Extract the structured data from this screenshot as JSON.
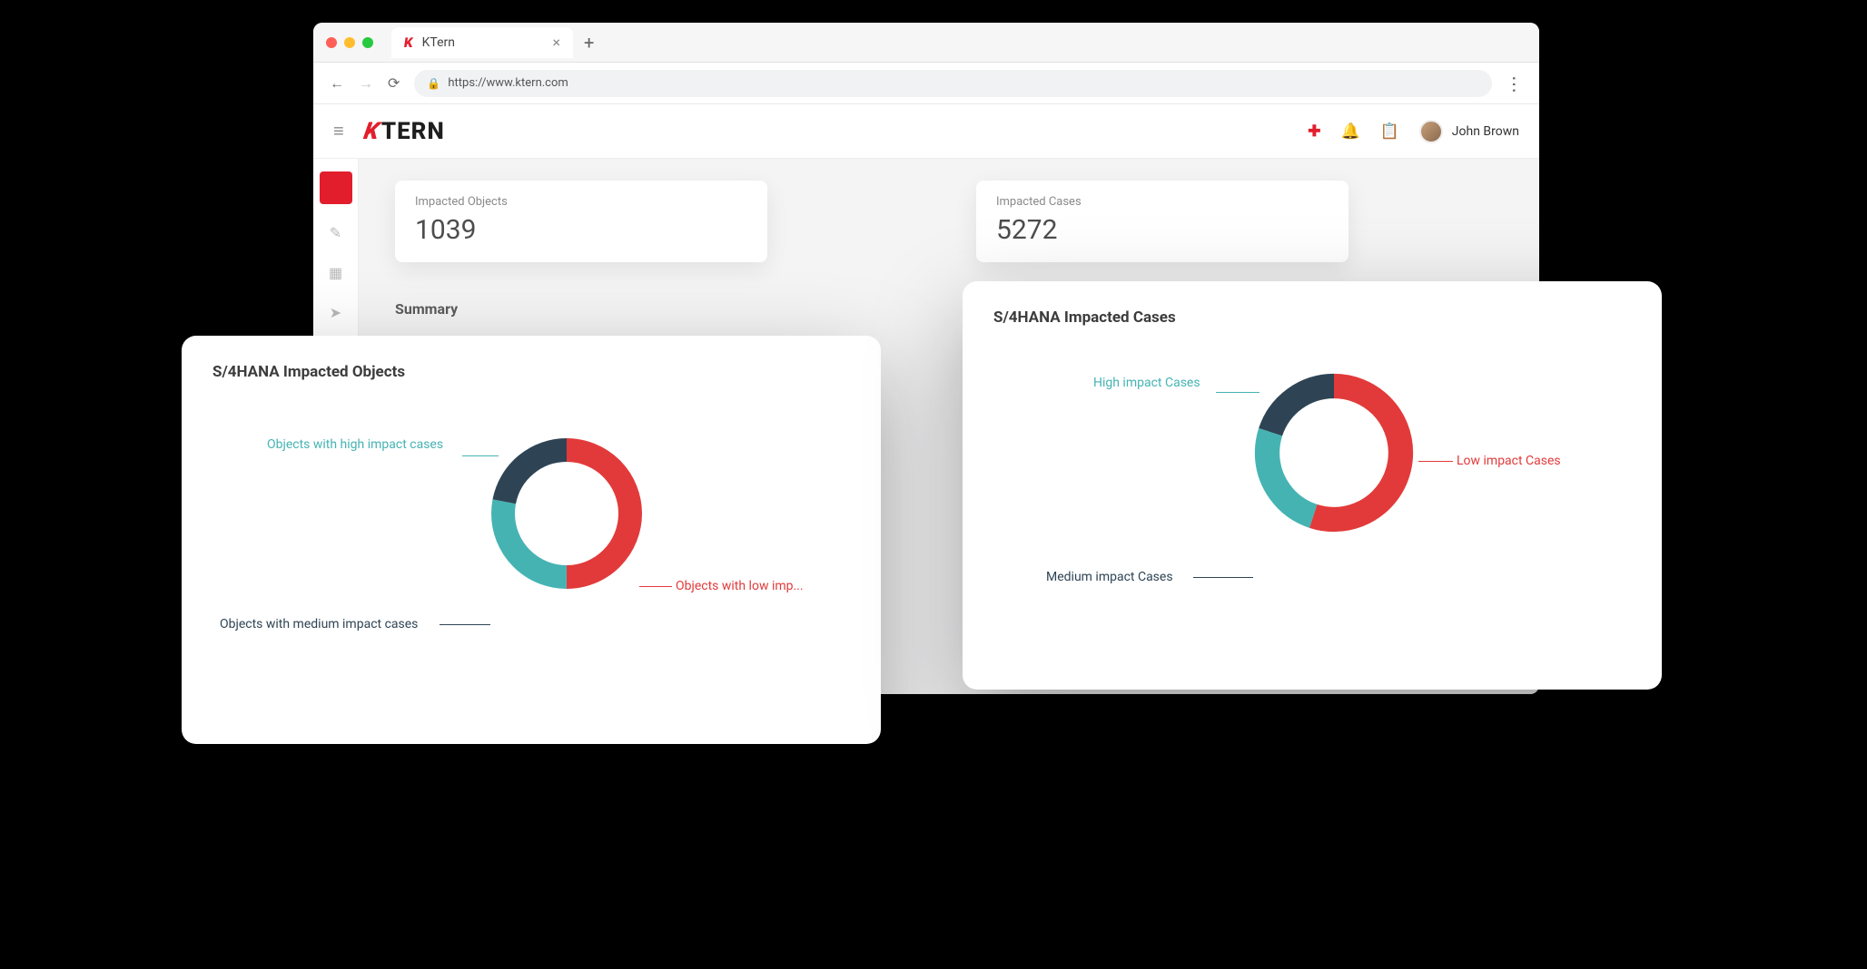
{
  "browser": {
    "tab_title": "KTern",
    "url": "https://www.ktern.com"
  },
  "header": {
    "brand_k": "K",
    "brand_rest": "TERN",
    "user_name": "John Brown"
  },
  "sidebar": {
    "items": [
      "home",
      "edit",
      "apps",
      "send",
      "more"
    ]
  },
  "metrics": [
    {
      "label": "Impacted Objects",
      "value": "1039"
    },
    {
      "label": "Impacted Cases",
      "value": "5272"
    }
  ],
  "summary_heading": "Summary",
  "charts": {
    "objects": {
      "title": "S/4HANA Impacted Objects",
      "labels": {
        "high": "Objects with high impact cases",
        "medium": "Objects with medium impact cases",
        "low": "Objects with low imp..."
      }
    },
    "cases": {
      "title": "S/4HANA Impacted Cases",
      "labels": {
        "high": "High impact Cases",
        "medium": "Medium impact Cases",
        "low": "Low impact Cases"
      }
    }
  },
  "chart_data": [
    {
      "type": "pie",
      "title": "S/4HANA Impacted Objects",
      "series": [
        {
          "name": "Objects with low impact cases",
          "value": 50,
          "color": "#e23a3a"
        },
        {
          "name": "Objects with high impact cases",
          "value": 28,
          "color": "#46b3b3"
        },
        {
          "name": "Objects with medium impact cases",
          "value": 22,
          "color": "#2e4454"
        }
      ]
    },
    {
      "type": "pie",
      "title": "S/4HANA Impacted Cases",
      "series": [
        {
          "name": "Low impact Cases",
          "value": 55,
          "color": "#e23a3a"
        },
        {
          "name": "High impact Cases",
          "value": 25,
          "color": "#46b3b3"
        },
        {
          "name": "Medium impact Cases",
          "value": 20,
          "color": "#2e4454"
        }
      ]
    }
  ]
}
